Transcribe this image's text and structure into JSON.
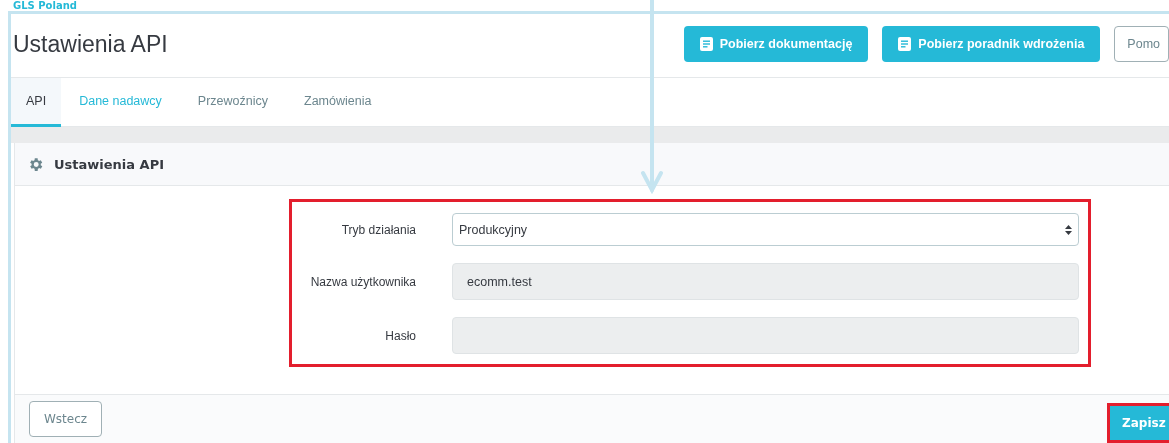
{
  "breadcrumb": "GLS Poland",
  "title": "Ustawienia API",
  "toolbar_buttons": [
    {
      "label": "Pobierz dokumentację",
      "kind": "primary"
    },
    {
      "label": "Pobierz poradnik wdrożenia",
      "kind": "primary"
    },
    {
      "label": "Pomo",
      "kind": "outline"
    }
  ],
  "tabs": [
    {
      "label": "API",
      "selected": true,
      "hovered": false
    },
    {
      "label": "Dane nadawcy",
      "selected": false,
      "hovered": true
    },
    {
      "label": "Przewoźnicy",
      "selected": false,
      "hovered": false
    },
    {
      "label": "Zamówienia",
      "selected": false,
      "hovered": false
    }
  ],
  "panel": {
    "title": "Ustawienia API",
    "fields": [
      {
        "label": "Tryb działania",
        "kind": "select",
        "value": "Produkcyjny"
      },
      {
        "label": "Nazwa użytkownika",
        "kind": "readonly",
        "value": "ecomm.test"
      },
      {
        "label": "Hasło",
        "kind": "readonly"
      }
    ],
    "back_button": "Wstecz",
    "save_button": "Zapisz"
  }
}
